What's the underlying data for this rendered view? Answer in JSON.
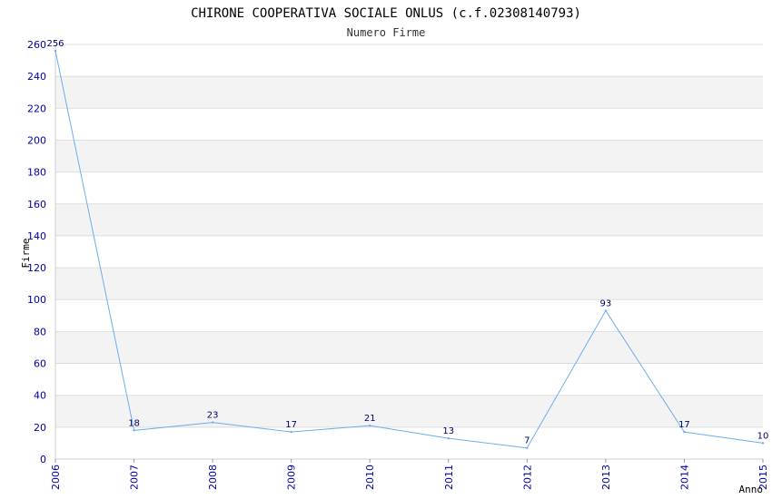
{
  "chart_data": {
    "type": "line",
    "title": "CHIRONE COOPERATIVA SOCIALE ONLUS (c.f.02308140793)",
    "subtitle": "Numero Firme",
    "xlabel": "Anno",
    "ylabel": "Firme",
    "x": [
      "2006",
      "2007",
      "2008",
      "2009",
      "2010",
      "2011",
      "2012",
      "2013",
      "2014",
      "2015"
    ],
    "values": [
      256,
      18,
      23,
      17,
      21,
      13,
      7,
      93,
      17,
      10
    ],
    "data_labels": [
      "256",
      "18",
      "23",
      "17",
      "21",
      "13",
      "7",
      "93",
      "17",
      "10"
    ],
    "ylim": [
      0,
      260
    ],
    "yticks": [
      "0",
      "20",
      "40",
      "60",
      "80",
      "100",
      "120",
      "140",
      "160",
      "180",
      "200",
      "220",
      "240",
      "260"
    ],
    "grid": true,
    "legend": "none",
    "colors": {
      "line": "#6aaef0",
      "band": "#f3f3f3",
      "gridline": "#dddddd",
      "tick_text": "#0000aa",
      "label_text": "#000066"
    }
  }
}
